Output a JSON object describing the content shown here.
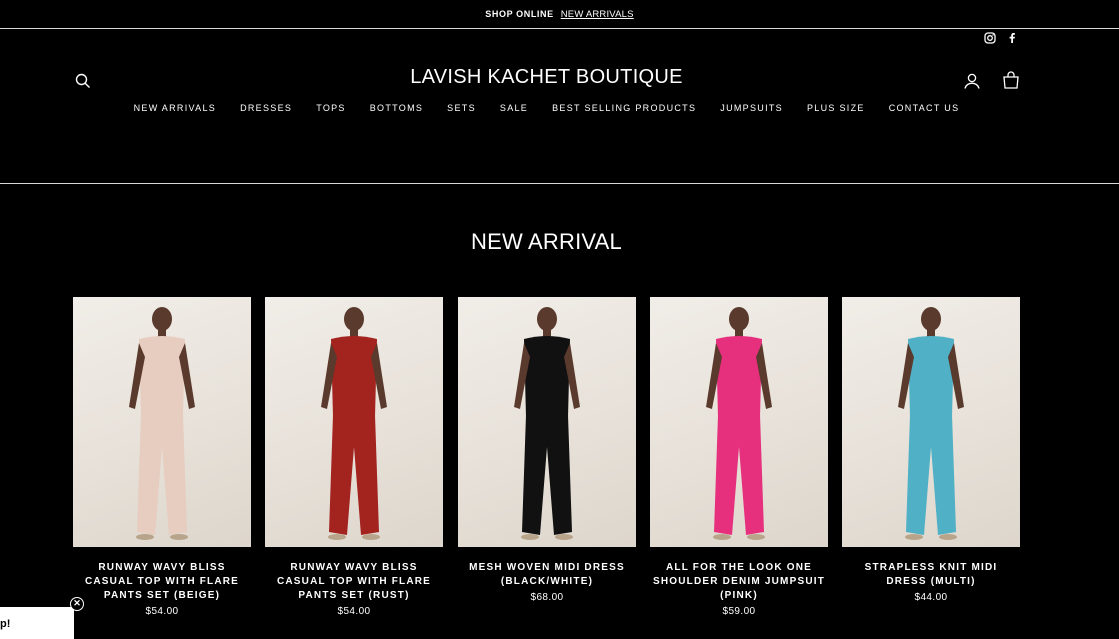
{
  "announcement": {
    "label": "SHOP ONLINE",
    "link": "NEW ARRIVALS"
  },
  "header": {
    "brand": "LAVISH KACHET BOUTIQUE"
  },
  "nav": [
    "NEW ARRIVALS",
    "DRESSES",
    "TOPS",
    "BOTTOMS",
    "SETS",
    "SALE",
    "BEST SELLING PRODUCTS",
    "JUMPSUITS",
    "PLUS SIZE",
    "CONTACT US"
  ],
  "section": {
    "title": "NEW ARRIVAL"
  },
  "products": [
    {
      "title": "RUNWAY WAVY BLISS CASUAL TOP WITH FLARE PANTS SET (BEIGE)",
      "price": "$54.00",
      "color": "#e7cdbf"
    },
    {
      "title": "RUNWAY WAVY BLISS CASUAL TOP WITH FLARE PANTS SET (RUST)",
      "price": "$54.00",
      "color": "#a3231f"
    },
    {
      "title": "MESH WOVEN MIDI DRESS (BLACK/WHITE)",
      "price": "$68.00",
      "color": "#111111"
    },
    {
      "title": "ALL FOR THE LOOK ONE SHOULDER DENIM JUMPSUIT (PINK)",
      "price": "$59.00",
      "color": "#e6307e"
    },
    {
      "title": "STRAPLESS KNIT MIDI DRESS (MULTI)",
      "price": "$44.00",
      "color": "#4fb0c6"
    }
  ],
  "popup": {
    "text": "p!",
    "close": "✕"
  },
  "icons": [
    "search-icon",
    "account-icon",
    "cart-icon",
    "instagram-icon",
    "facebook-icon",
    "close-icon"
  ]
}
